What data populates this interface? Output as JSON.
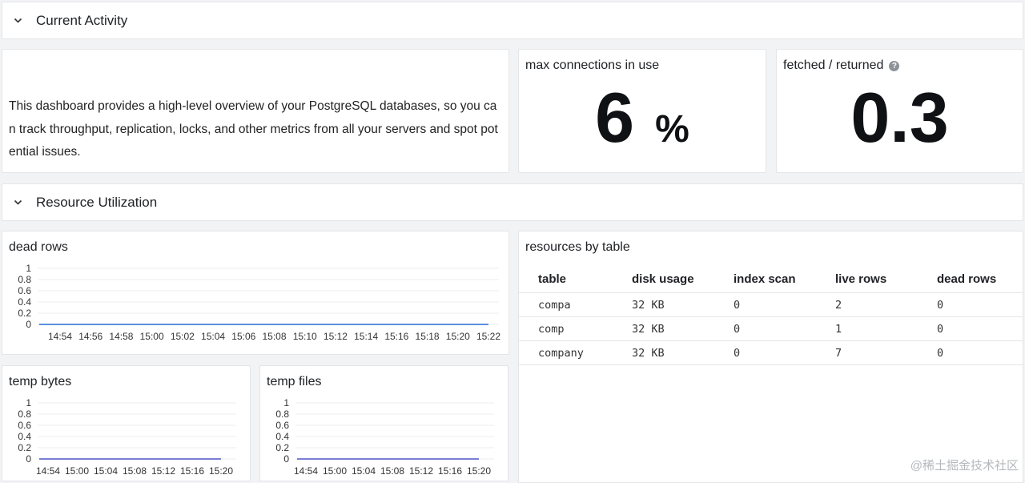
{
  "rows": {
    "current_activity": "Current Activity",
    "resource_utilization": "Resource Utilization"
  },
  "description": "This dashboard provides a high-level overview of your PostgreSQL databases, so you can track throughput, replication, locks, and other metrics from all your servers and spot potential issues.",
  "max_connections": {
    "title": "max connections in use",
    "value": "6",
    "unit": "%"
  },
  "fetched_returned": {
    "title": "fetched / returned",
    "value": "0.3",
    "help_icon": "question-circle-icon"
  },
  "icons": {
    "row_toggle": "chevron-down-icon"
  },
  "colors": {
    "dead_rows_line": "#5b8fe0",
    "temp_line": "#7b7fd4",
    "grid": "#ececec"
  },
  "chart_data": [
    {
      "type": "line",
      "title": "dead rows",
      "x": [
        "14:54",
        "14:56",
        "14:58",
        "15:00",
        "15:02",
        "15:04",
        "15:06",
        "15:08",
        "15:10",
        "15:12",
        "15:14",
        "15:16",
        "15:18",
        "15:20",
        "15:22"
      ],
      "y_ticks": [
        "1",
        "0.8",
        "0.6",
        "0.4",
        "0.2",
        "0"
      ],
      "ylim": [
        0,
        1
      ],
      "series": [
        {
          "values": [
            0,
            0,
            0,
            0,
            0,
            0,
            0,
            0,
            0,
            0,
            0,
            0,
            0,
            0,
            0
          ]
        }
      ],
      "grid": true
    },
    {
      "type": "line",
      "title": "temp bytes",
      "x": [
        "14:54",
        "15:00",
        "15:04",
        "15:08",
        "15:12",
        "15:16",
        "15:20"
      ],
      "y_ticks": [
        "1",
        "0.8",
        "0.6",
        "0.4",
        "0.2",
        "0"
      ],
      "ylim": [
        0,
        1
      ],
      "series": [
        {
          "values": [
            0,
            0,
            0,
            0,
            0,
            0,
            0
          ]
        }
      ],
      "grid": true
    },
    {
      "type": "line",
      "title": "temp files",
      "x": [
        "14:54",
        "15:00",
        "15:04",
        "15:08",
        "15:12",
        "15:16",
        "15:20"
      ],
      "y_ticks": [
        "1",
        "0.8",
        "0.6",
        "0.4",
        "0.2",
        "0"
      ],
      "ylim": [
        0,
        1
      ],
      "series": [
        {
          "values": [
            0,
            0,
            0,
            0,
            0,
            0,
            0
          ]
        }
      ],
      "grid": true
    }
  ],
  "resources_table": {
    "title": "resources by table",
    "columns": [
      "table",
      "disk usage",
      "index scan",
      "live rows",
      "dead rows"
    ],
    "rows": [
      [
        "compa",
        "32 KB",
        "0",
        "2",
        "0"
      ],
      [
        "comp",
        "32 KB",
        "0",
        "1",
        "0"
      ],
      [
        "company",
        "32 KB",
        "0",
        "7",
        "0"
      ]
    ]
  },
  "watermark": "@稀土掘金技术社区"
}
